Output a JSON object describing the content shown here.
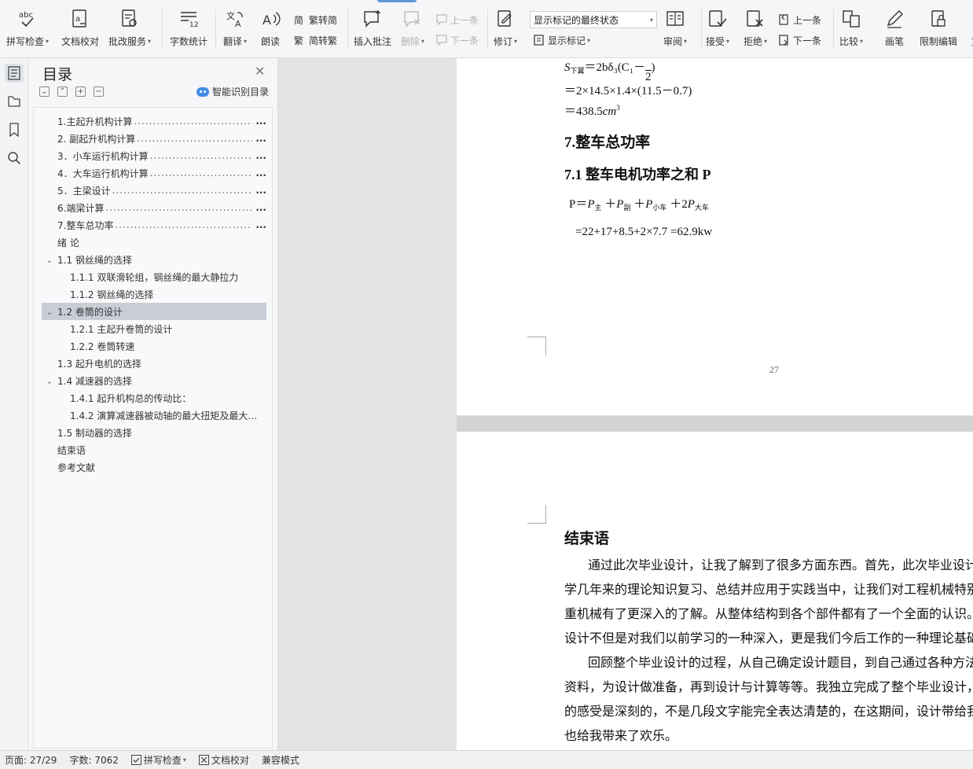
{
  "ribbon": {
    "spell_check": "拼写检查",
    "doc_proofread": "文档校对",
    "review_service": "批改服务",
    "word_count": "字数统计",
    "translate": "翻译",
    "read_aloud": "朗读",
    "trad_to_simp": "繁转简",
    "simp_to_trad": "简转繁",
    "insert_comment": "插入批注",
    "delete": "删除",
    "prev_comment": "上一条",
    "next_comment": "下一条",
    "revise": "修订",
    "markup_state": "显示标记的最终状态",
    "show_markup": "显示标记",
    "review": "审阅",
    "accept": "接受",
    "reject": "拒绝",
    "prev_change": "上一条",
    "next_change": "下一条",
    "compare": "比较",
    "pen": "画笔",
    "restrict_edit": "限制编辑",
    "overflow_label": "文"
  },
  "toc": {
    "title": "目录",
    "smart_label": "智能识别目录",
    "items": [
      {
        "text": "1.主起升机构计算",
        "level": 1,
        "dots": true
      },
      {
        "text": "2. 副起升机构计算",
        "level": 1,
        "dots": true
      },
      {
        "text": "3．小车运行机构计算",
        "level": 1,
        "dots": true
      },
      {
        "text": "4．大车运行机构计算",
        "level": 1,
        "dots": true
      },
      {
        "text": "5．主梁设计",
        "level": 1,
        "dots": true
      },
      {
        "text": "6.端梁计算",
        "level": 1,
        "dots": true
      },
      {
        "text": "7.整车总功率",
        "level": 1,
        "dots": true
      },
      {
        "text": "绪  论",
        "level": 1,
        "dots": false
      },
      {
        "text": "1.1 钢丝绳的选择",
        "level": 1,
        "dots": false,
        "expand": true
      },
      {
        "text": "1.1.1 双联滑轮组，钢丝绳的最大静拉力",
        "level": 2,
        "dots": false
      },
      {
        "text": "1.1.2 钢丝绳的选择",
        "level": 2,
        "dots": false
      },
      {
        "text": "1.2 卷筒的设计",
        "level": 1,
        "dots": false,
        "expand": true,
        "selected": true
      },
      {
        "text": "1.2.1 主起升卷筒的设计",
        "level": 2,
        "dots": false
      },
      {
        "text": "1.2.2 卷筒转速",
        "level": 2,
        "dots": false
      },
      {
        "text": "1.3 起升电机的选择",
        "level": 1,
        "dots": false
      },
      {
        "text": "1.4 减速器的选择",
        "level": 1,
        "dots": false,
        "expand": true
      },
      {
        "text": "1.4.1 起升机构总的传动比：",
        "level": 2,
        "dots": false
      },
      {
        "text": "1.4.2 演算减速器被动轴的最大扭矩及最大…",
        "level": 2,
        "dots": false
      },
      {
        "text": "1.5 制动器的选择",
        "level": 1,
        "dots": false
      },
      {
        "text": "结束语",
        "level": 1,
        "dots": false
      },
      {
        "text": "参考文献",
        "level": 1,
        "dots": false
      }
    ]
  },
  "doc": {
    "formula_line1_s": "S",
    "formula_line1_sub": "下翼",
    "formula_line1_rest": "＝2bδ₃(C₁－",
    "formula_line1_frac_den": "2",
    "formula_line2": "＝2×14.5×1.4×(11.5－0.7)",
    "formula_line3_num": "＝438.5",
    "formula_line3_unit": "cm",
    "formula_line3_sup": "3",
    "heading_7": "7.整车总功率",
    "heading_71": "7.1 整车电机功率之和 P",
    "power_p": "P＝",
    "power_sub_main": "主",
    "power_sub_aux": "副",
    "power_sub_small": "小车",
    "power_sub_big": "大车",
    "power_calc": "=22+17+8.5+2×7.7 =62.9kw",
    "page_number": "27",
    "conclusion_title": "结束语",
    "conclusion_lines": [
      "通过此次毕业设计，让我了解到了很多方面东西。首先，此次毕业设计",
      "学几年来的理论知识复习、总结并应用于实践当中，让我们对工程机械特别",
      "重机械有了更深入的了解。从整体结构到各个部件都有了一个全面的认识。",
      "设计不但是对我们以前学习的一种深入，更是我们今后工作的一种理论基础",
      "回顾整个毕业设计的过程，从自己确定设计题目，到自己通过各种方法",
      "资料，为设计做准备，再到设计与计算等等。我独立完成了整个毕业设计，",
      "的感受是深刻的，不是几段文字能完全表达清楚的，在这期间，设计带给我",
      "也给我带来了欢乐。"
    ]
  },
  "status": {
    "page": "页面: 27/29",
    "words": "字数: 7062",
    "spell": "拼写检查",
    "proof": "文档校对",
    "compat": "兼容模式"
  }
}
